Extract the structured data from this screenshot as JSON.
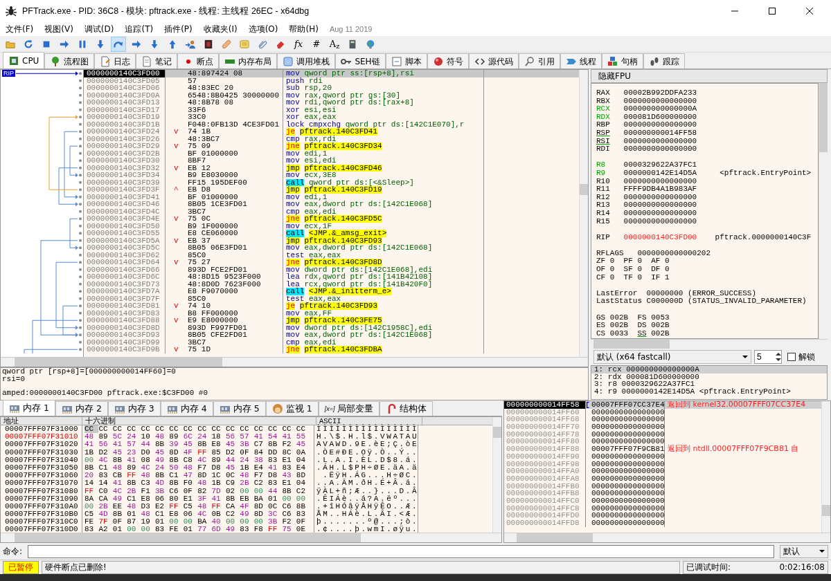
{
  "window": {
    "title": "PFTrack.exe - PID: 36C8 - 模块: pftrack.exe - 线程: 主线程 26EC - x64dbg"
  },
  "menu": {
    "items": [
      "文件(F)",
      "视图(V)",
      "调试(D)",
      "追踪(T)",
      "插件(P)",
      "收藏夹(I)",
      "选项(O)",
      "帮助(H)"
    ],
    "build_date": "Aug 11 2019"
  },
  "toolbar": [
    {
      "kind": "folder",
      "pressed": false
    },
    {
      "kind": "restart",
      "pressed": false
    },
    {
      "kind": "stop",
      "pressed": false
    },
    {
      "kind": "run",
      "pressed": false
    },
    {
      "kind": "pause",
      "pressed": false
    },
    {
      "kind": "step_into",
      "pressed": false
    },
    {
      "kind": "step_over",
      "pressed": true
    },
    {
      "kind": "run",
      "pressed": false
    },
    {
      "kind": "step_into",
      "pressed": false
    },
    {
      "kind": "step_out",
      "pressed": false
    },
    {
      "kind": "person",
      "pressed": false
    },
    {
      "kind": "tile",
      "pressed": false
    },
    {
      "kind": "bandage",
      "pressed": false
    },
    {
      "kind": "note",
      "pressed": false
    },
    {
      "kind": "paperclip",
      "pressed": false
    },
    {
      "kind": "eraser",
      "pressed": false
    },
    {
      "kind": "glyph",
      "text": "*fx*",
      "pressed": false
    },
    {
      "kind": "glyph",
      "text": "#",
      "pressed": false
    },
    {
      "kind": "glyph",
      "text": "A$_{z}$",
      "pressed": false
    },
    {
      "kind": "calculator",
      "pressed": false
    },
    {
      "kind": "globe",
      "pressed": false
    }
  ],
  "tabs": [
    {
      "label": "CPU",
      "selected": true
    },
    {
      "label": "流程图",
      "selected": false
    },
    {
      "label": "日志",
      "selected": false
    },
    {
      "label": "笔记",
      "selected": false
    },
    {
      "label": "断点",
      "selected": false
    },
    {
      "label": "内存布局",
      "selected": false
    },
    {
      "label": "调用堆栈",
      "selected": false
    },
    {
      "label": "SEH链",
      "selected": false
    },
    {
      "label": "脚本",
      "selected": false
    },
    {
      "label": "符号",
      "selected": false
    },
    {
      "label": "源代码",
      "selected": false
    },
    {
      "label": "引用",
      "selected": false
    },
    {
      "label": "线程",
      "selected": false
    },
    {
      "label": "句柄",
      "selected": false
    },
    {
      "label": "跟踪",
      "selected": false
    }
  ],
  "disasm": {
    "rip_label": "RIP",
    "rows": [
      {
        "address": "0000000140C3FD00",
        "bytes": "48:897424 08",
        "mnemonic": "mov",
        "operands": "qword ptr ss:[rsp+8],rsi",
        "kind": "normal",
        "target": false,
        "selected": true
      },
      {
        "address": "0000000140C3FD05",
        "bytes": "57",
        "mnemonic": "push",
        "operands": "rdi",
        "kind": "normal",
        "target": false,
        "selected": false
      },
      {
        "address": "0000000140C3FD06",
        "bytes": "48:83EC 20",
        "mnemonic": "sub",
        "operands": "rsp,20",
        "kind": "normal",
        "target": false,
        "selected": false
      },
      {
        "address": "0000000140C3FD0A",
        "bytes": "6548:8B0425 30000000",
        "mnemonic": "mov",
        "operands": "rax,qword ptr gs:[30]",
        "kind": "normal",
        "target": false,
        "selected": false
      },
      {
        "address": "0000000140C3FD13",
        "bytes": "48:8B78 08",
        "mnemonic": "mov",
        "operands": "rdi,qword ptr ds:[rax+8]",
        "kind": "normal",
        "target": false,
        "selected": false
      },
      {
        "address": "0000000140C3FD17",
        "bytes": "33F6",
        "mnemonic": "xor",
        "operands": "esi,esi",
        "kind": "normal",
        "target": false,
        "selected": false
      },
      {
        "address": "0000000140C3FD19",
        "bytes": "33C0",
        "mnemonic": "xor",
        "operands": "eax,eax",
        "kind": "normal",
        "target": false,
        "selected": false
      },
      {
        "address": "0000000140C3FD1B",
        "bytes": "F048:0FB13D 4CE3FD01",
        "mnemonic": "lock cmpxchg",
        "operands": "qword ptr ds:[142C1E070],r",
        "kind": "normal",
        "target": false,
        "selected": false
      },
      {
        "address": "0000000140C3FD24",
        "branch": "v",
        "bytes": "74 1B",
        "mnemonic": "je",
        "operands": "pftrack.140C3FD41",
        "kind": "cond_jump",
        "target": true,
        "selected": false
      },
      {
        "address": "0000000140C3FD26",
        "bytes": "48:3BC7",
        "mnemonic": "cmp",
        "operands": "rax,rdi",
        "kind": "normal",
        "target": false,
        "selected": false
      },
      {
        "address": "0000000140C3FD29",
        "branch": "v",
        "bytes": "75 09",
        "mnemonic": "jne",
        "operands": "pftrack.140C3FD34",
        "kind": "cond_jump",
        "target": true,
        "selected": false
      },
      {
        "address": "0000000140C3FD2B",
        "bytes": "BF 01000000",
        "mnemonic": "mov",
        "operands": "edi,1",
        "kind": "normal",
        "target": false,
        "selected": false
      },
      {
        "address": "0000000140C3FD30",
        "bytes": "8BF7",
        "mnemonic": "mov",
        "operands": "esi,edi",
        "kind": "normal",
        "target": false,
        "selected": false
      },
      {
        "address": "0000000140C3FD32",
        "branch": "v",
        "bytes": "EB 12",
        "mnemonic": "jmp",
        "operands": "pftrack.140C3FD46",
        "kind": "jump",
        "target": true,
        "selected": false
      },
      {
        "address": "0000000140C3FD34",
        "bytes": "B9 E8030000",
        "mnemonic": "mov",
        "operands": "ecx,3E8",
        "kind": "normal",
        "target": false,
        "selected": false
      },
      {
        "address": "0000000140C3FD39",
        "bytes": "FF15 195DEF00",
        "mnemonic": "call",
        "operands": "qword ptr ds:[<&Sleep>]",
        "kind": "call",
        "target": false,
        "selected": false
      },
      {
        "address": "0000000140C3FD3F",
        "branch": "^",
        "bytes": "EB D8",
        "mnemonic": "jmp",
        "operands": "pftrack.140C3FD19",
        "kind": "jump",
        "target": true,
        "selected": false
      },
      {
        "address": "0000000140C3FD41",
        "bytes": "BF 01000000",
        "mnemonic": "mov",
        "operands": "edi,1",
        "kind": "normal",
        "target": false,
        "selected": false
      },
      {
        "address": "0000000140C3FD46",
        "bytes": "8B05 1CE3FD01",
        "mnemonic": "mov",
        "operands": "eax,dword ptr ds:[142C1E068]",
        "kind": "normal",
        "target": false,
        "selected": false
      },
      {
        "address": "0000000140C3FD4C",
        "bytes": "3BC7",
        "mnemonic": "cmp",
        "operands": "eax,edi",
        "kind": "normal",
        "target": false,
        "selected": false
      },
      {
        "address": "0000000140C3FD4E",
        "branch": "v",
        "bytes": "75 0C",
        "mnemonic": "jne",
        "operands": "pftrack.140C3FD5C",
        "kind": "cond_jump",
        "target": true,
        "selected": false
      },
      {
        "address": "0000000140C3FD50",
        "bytes": "B9 1F000000",
        "mnemonic": "mov",
        "operands": "ecx,1F",
        "kind": "normal",
        "target": false,
        "selected": false
      },
      {
        "address": "0000000140C3FD55",
        "bytes": "E8 CE060000",
        "mnemonic": "call",
        "operands": "<JMP.&_amsg_exit>",
        "kind": "call",
        "target": true,
        "selected": false
      },
      {
        "address": "0000000140C3FD5A",
        "branch": "v",
        "bytes": "EB 37",
        "mnemonic": "jmp",
        "operands": "pftrack.140C3FD93",
        "kind": "jump",
        "target": true,
        "selected": false
      },
      {
        "address": "0000000140C3FD5C",
        "bytes": "8B05 06E3FD01",
        "mnemonic": "mov",
        "operands": "eax,dword ptr ds:[142C1E068]",
        "kind": "normal",
        "target": false,
        "selected": false
      },
      {
        "address": "0000000140C3FD62",
        "bytes": "85C0",
        "mnemonic": "test",
        "operands": "eax,eax",
        "kind": "normal",
        "target": false,
        "selected": false
      },
      {
        "address": "0000000140C3FD64",
        "branch": "v",
        "bytes": "75 27",
        "mnemonic": "jne",
        "operands": "pftrack.140C3FD8D",
        "kind": "cond_jump",
        "target": true,
        "selected": false
      },
      {
        "address": "0000000140C3FD66",
        "bytes": "893D FCE2FD01",
        "mnemonic": "mov",
        "operands": "dword ptr ds:[142C1E068],edi",
        "kind": "normal",
        "target": false,
        "selected": false
      },
      {
        "address": "0000000140C3FD6C",
        "bytes": "48:8D15 9523F000",
        "mnemonic": "lea",
        "operands": "rdx,qword ptr ds:[141B42108]",
        "kind": "normal",
        "target": false,
        "selected": false
      },
      {
        "address": "0000000140C3FD73",
        "bytes": "48:8D0D 7623F000",
        "mnemonic": "lea",
        "operands": "rcx,qword ptr ds:[141B420F0]",
        "kind": "normal",
        "target": false,
        "selected": false
      },
      {
        "address": "0000000140C3FD7A",
        "bytes": "E8 F9070000",
        "mnemonic": "call",
        "operands": "<JMP.&_initterm_e>",
        "kind": "call",
        "target": true,
        "selected": false
      },
      {
        "address": "0000000140C3FD7F",
        "bytes": "85C0",
        "mnemonic": "test",
        "operands": "eax,eax",
        "kind": "normal",
        "target": false,
        "selected": false
      },
      {
        "address": "0000000140C3FD81",
        "branch": "v",
        "bytes": "74 10",
        "mnemonic": "je",
        "operands": "pftrack.140C3FD93",
        "kind": "cond_jump",
        "target": true,
        "selected": false
      },
      {
        "address": "0000000140C3FD83",
        "bytes": "B8 FF000000",
        "mnemonic": "mov",
        "operands": "eax,FF",
        "kind": "normal",
        "target": false,
        "selected": false
      },
      {
        "address": "0000000140C3FD88",
        "branch": "v",
        "bytes": "E9 E8000000",
        "mnemonic": "jmp",
        "operands": "pftrack.140C3FE75",
        "kind": "jump",
        "target": true,
        "selected": false
      },
      {
        "address": "0000000140C3FD8D",
        "bytes": "893D F997FD01",
        "mnemonic": "mov",
        "operands": "dword ptr ds:[142C1958C],edi",
        "kind": "normal",
        "target": false,
        "selected": false
      },
      {
        "address": "0000000140C3FD93",
        "bytes": "8B05 CFE2FD01",
        "mnemonic": "mov",
        "operands": "eax,dword ptr ds:[142C1E068]",
        "kind": "normal",
        "target": false,
        "selected": false
      },
      {
        "address": "0000000140C3FD99",
        "bytes": "3BC7",
        "mnemonic": "cmp",
        "operands": "eax,edi",
        "kind": "normal",
        "target": false,
        "selected": false
      },
      {
        "address": "0000000140C3FD9B",
        "branch": "v",
        "bytes": "75 1D",
        "mnemonic": "jne",
        "operands": "pftrack.140C3FDBA",
        "kind": "cond_jump",
        "target": true,
        "selected": false
      }
    ]
  },
  "info": {
    "lines": [
      "qword ptr [rsp+8]=[000000000014FF60]=0",
      "rsi=0"
    ],
    "footer": "amped:0000000140C3FD00 pftrack.exe:$C3FD00 #0"
  },
  "registers": {
    "header": "隐藏FPU",
    "groups": [
      [
        {
          "name": "RAX",
          "value": "00002B992DDFA233",
          "changed": false,
          "underlined": false
        },
        {
          "name": "RBX",
          "value": "0000000000000000",
          "changed": false,
          "underlined": false
        },
        {
          "name": "RCX",
          "value": "000000000000000A",
          "changed": true,
          "underlined": false
        },
        {
          "name": "RDX",
          "value": "000081D600000000",
          "changed": true,
          "underlined": false
        },
        {
          "name": "RBP",
          "value": "0000000000000000",
          "changed": false,
          "underlined": false
        },
        {
          "name": "RSP",
          "value": "000000000014FF58",
          "changed": false,
          "underlined": true
        },
        {
          "name": "RSI",
          "value": "0000000000000000",
          "changed": false,
          "underlined": true
        },
        {
          "name": "RDI",
          "value": "0000000000000000",
          "changed": false,
          "underlined": false
        }
      ],
      [
        {
          "name": "R8",
          "value": "0000329622A37FC1",
          "changed": true,
          "underlined": false
        },
        {
          "name": "R9",
          "value": "0000000142E14D5A",
          "comment": "<pftrack.EntryPoint>",
          "changed": true,
          "underlined": false
        },
        {
          "name": "R10",
          "value": "0000000000000000",
          "changed": false,
          "underlined": false
        },
        {
          "name": "R11",
          "value": "FFFF9DB4A1B983AF",
          "changed": false,
          "underlined": false
        },
        {
          "name": "R12",
          "value": "0000000000000000",
          "changed": false,
          "underlined": false
        },
        {
          "name": "R13",
          "value": "0000000000000000",
          "changed": false,
          "underlined": false
        },
        {
          "name": "R14",
          "value": "0000000000000000",
          "changed": false,
          "underlined": false
        },
        {
          "name": "R15",
          "value": "0000000000000000",
          "changed": false,
          "underlined": false
        }
      ]
    ],
    "rip": {
      "name": "RIP",
      "value": "0000000140C3FD00",
      "comment": "pftrack.0000000140C3F"
    },
    "rflags": {
      "name": "RFLAGS",
      "value": "0000000000000202"
    },
    "flags": [
      [
        {
          "name": "ZF",
          "value": "0"
        },
        {
          "name": "PF",
          "value": "0"
        },
        {
          "name": "AF",
          "value": "0"
        }
      ],
      [
        {
          "name": "OF",
          "value": "0"
        },
        {
          "name": "SF",
          "value": "0"
        },
        {
          "name": "DF",
          "value": "0"
        }
      ],
      [
        {
          "name": "CF",
          "value": "0"
        },
        {
          "name": "TF",
          "value": "0"
        },
        {
          "name": "IF",
          "value": "1"
        }
      ]
    ],
    "last": [
      {
        "name": "LastError",
        "value": "00000000",
        "text": "(ERROR_SUCCESS)"
      },
      {
        "name": "LastStatus",
        "value": "C000000D",
        "text": "(STATUS_INVALID_PARAMETER)"
      }
    ],
    "segments": [
      [
        {
          "name": "GS",
          "value": "002B",
          "underlined": false
        },
        {
          "name": "FS",
          "value": "0053",
          "underlined": false
        }
      ],
      [
        {
          "name": "ES",
          "value": "002B",
          "underlined": false
        },
        {
          "name": "DS",
          "value": "002B",
          "underlined": false
        }
      ],
      [
        {
          "name": "CS",
          "value": "0033",
          "underlined": false
        },
        {
          "name": "SS",
          "value": "002B",
          "underlined": true
        }
      ]
    ]
  },
  "arguments": {
    "convention": "默认 (x64 fastcall)",
    "count": "5",
    "unlock": {
      "label": "解锁",
      "checked": false
    },
    "items": [
      {
        "text": "1: rcx 000000000000000A",
        "selected": true
      },
      {
        "text": "2: rdx 000081D600000000",
        "selected": false
      },
      {
        "text": "3: r8 0000329622A37FC1",
        "selected": false
      },
      {
        "text": "4: r9 0000000142E14D5A <pftrack.EntryPoint>",
        "selected": false
      }
    ]
  },
  "dump_tabs": [
    {
      "label": "内存 1",
      "selected": true
    },
    {
      "label": "内存 2",
      "selected": false
    },
    {
      "label": "内存 3",
      "selected": false
    },
    {
      "label": "内存 4",
      "selected": false
    },
    {
      "label": "内存 5",
      "selected": false
    },
    {
      "label": "监视 1",
      "selected": false
    },
    {
      "label": "局部变量",
      "icon_text": "[x=]",
      "selected": false
    },
    {
      "label": "结构体",
      "selected": false
    }
  ],
  "dump": {
    "columns": [
      "地址",
      "十六进制",
      "ASCII"
    ],
    "rows": [
      {
        "address": "00007FFF07F31000",
        "bytes": "CC CC CC CC CC CC CC CC CC CC CC CC CC CC CC CC",
        "ascii": "ÌÌÌÌÌÌÌÌÌÌÌÌÌÌÌÌ",
        "highlight": false
      },
      {
        "address": "00007FFF07F31010",
        "bytes": "48 89 5C 24 10 48 89 6C 24 18 56 57 41 54 41 55",
        "ascii": "H.\\$.H.l$.VWATAU",
        "highlight": true
      },
      {
        "address": "00007FFF07F31020",
        "bytes": "41 56 41 57 44 8B 39 45 8B E8 45 3B C7 8B F2 45",
        "ascii": "AVAWD.9E.èE;Ç.òE",
        "highlight": false
      },
      {
        "address": "00007FFF07F31030",
        "bytes": "1B D2 45 23 D0 45 8D 4F FF 85 D2 0F 84 DD 8C 0A",
        "ascii": ".ÒE#ÐE.Oÿ.Ò..Ý..",
        "highlight": false
      },
      {
        "address": "00007FFF07F31040",
        "bytes": "00 4C 8B 41 08 49 8B C8 4C 89 44 24 38 83 E1 04",
        "ascii": ".L.A.I.ÈL.D$8.á.",
        "highlight": false
      },
      {
        "address": "00007FFF07F31050",
        "bytes": "8B C1 48 89 4C 24 50 48 F7 D8 45 1B E4 41 83 E4",
        "ascii": ".ÁH.L$PH÷ØE.äA.ä",
        "highlight": false
      },
      {
        "address": "00007FFF07F31060",
        "bytes": "20 83 CB FF 48 8B C1 47 8D 1C 0C 48 F7 D8 43 8D",
        "ascii": " .ËÿH.ÁG...H÷ØC.",
        "highlight": false
      },
      {
        "address": "00007FFF07F31070",
        "bytes": "14 14 41 8B C3 4D 8B F0 48 1B C9 2B C2 83 E1 04",
        "ascii": "..A.ÃM.ðH.É+Â.á.",
        "highlight": false
      },
      {
        "address": "00007FFF07F31080",
        "bytes": "FF C0 4C 2B F1 3B C6 0F 82 7D 02 00 00 44 8B C2",
        "ascii": "ÿÀL+ñ;Æ..}...D.Â",
        "highlight": false
      },
      {
        "address": "00007FFF07F31090",
        "bytes": "8A CA 49 C1 E8 06 80 E1 3F 41 8B EB BA 01 00 00",
        "ascii": ".ÊIÁè..á?A.ëº...",
        "highlight": false
      },
      {
        "address": "00007FFF07F310A0",
        "bytes": "00 2B EE 48 D3 E2 FF C5 48 FF CA 4F 8D 0C C6 8B",
        "ascii": ".+îHÓâÿÅHÿÊO..Æ.",
        "highlight": false
      },
      {
        "address": "00007FFF07F310B0",
        "bytes": "C5 4D 8B 01 48 C1 E8 06 4C 0B C2 49 8D 3C C6 83",
        "ascii": "ÅM..HÁè.L.ÂI.<Æ.",
        "highlight": false
      },
      {
        "address": "00007FFF07F310C0",
        "bytes": "FE 7F 0F 87 19 01 00 00 BA 40 00 00 00 3B F2 0F",
        "ascii": "þ.......º@...;ò.",
        "highlight": false
      },
      {
        "address": "00007FFF07F310D0",
        "bytes": "83 A2 01 00 00 83 FE 01 77 6D 49 83 F8 FF 75 0E",
        "ascii": ".¢....þ.wmI.øÿu.",
        "highlight": false
      }
    ]
  },
  "stack": {
    "rows": [
      {
        "address": "000000000014FF58",
        "value": "00007FFF07CC37E4",
        "comment": "返回到 kernel32.00007FFF07CC37E4",
        "selected": true
      },
      {
        "address": "000000000014FF60",
        "value": "0000000000000000",
        "selected": false
      },
      {
        "address": "000000000014FF68",
        "value": "0000000000000000",
        "selected": false
      },
      {
        "address": "000000000014FF70",
        "value": "0000000000000000",
        "selected": false
      },
      {
        "address": "000000000014FF78",
        "value": "0000000000000000",
        "selected": false
      },
      {
        "address": "000000000014FF80",
        "value": "0000000000000000",
        "selected": false
      },
      {
        "address": "000000000014FF88",
        "value": "00007FFF07F9CB81",
        "comment": "返回到 ntdll.00007FFF07F9CB81 自",
        "selected": false
      },
      {
        "address": "000000000014FF90",
        "value": "0000000000000000",
        "selected": false
      },
      {
        "address": "000000000014FF98",
        "value": "0000000000000000",
        "selected": false
      },
      {
        "address": "000000000014FFA0",
        "value": "0000000000000000",
        "selected": false
      },
      {
        "address": "000000000014FFA8",
        "value": "0000000000000000",
        "selected": false
      },
      {
        "address": "000000000014FFB0",
        "value": "0000000000000000",
        "selected": false
      },
      {
        "address": "000000000014FFB8",
        "value": "0000000000000000",
        "selected": false
      },
      {
        "address": "000000000014FFC0",
        "value": "0000000000000000",
        "selected": false
      },
      {
        "address": "000000000014FFC8",
        "value": "0000000000000000",
        "selected": false
      },
      {
        "address": "000000000014FFD0",
        "value": "0000000000000000",
        "selected": false
      },
      {
        "address": "000000000014FFD8",
        "value": "0000000000000000",
        "selected": false
      }
    ]
  },
  "command": {
    "label": "命令:",
    "mode": "默认"
  },
  "status": {
    "state": "已暂停",
    "message": "硬件断点已删除!",
    "elapsed_label": "已调试时间:",
    "elapsed": "0:02:16:08"
  }
}
